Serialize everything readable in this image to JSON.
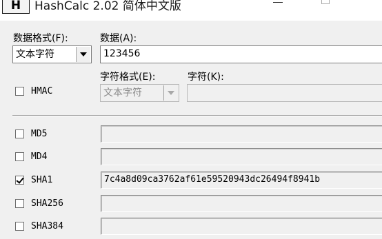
{
  "window": {
    "icon_letter": "H",
    "title": "HashCalc 2.02 简体中文版"
  },
  "data_format": {
    "label": "数据格式(F):",
    "value": "文本字符"
  },
  "data": {
    "label": "数据(A):",
    "value": "123456"
  },
  "hmac": {
    "label": "HMAC",
    "checked": false,
    "key_format_label": "字符格式(E):",
    "key_format_value": "文本字符",
    "key_label": "字符(K):",
    "key_value": ""
  },
  "hashes": [
    {
      "label": "MD5",
      "checked": false,
      "value": ""
    },
    {
      "label": "MD4",
      "checked": false,
      "value": ""
    },
    {
      "label": "SHA1",
      "checked": true,
      "value": "7c4a8d09ca3762af61e59520943dc26494f8941b"
    },
    {
      "label": "SHA256",
      "checked": false,
      "value": ""
    },
    {
      "label": "SHA384",
      "checked": false,
      "value": ""
    }
  ]
}
